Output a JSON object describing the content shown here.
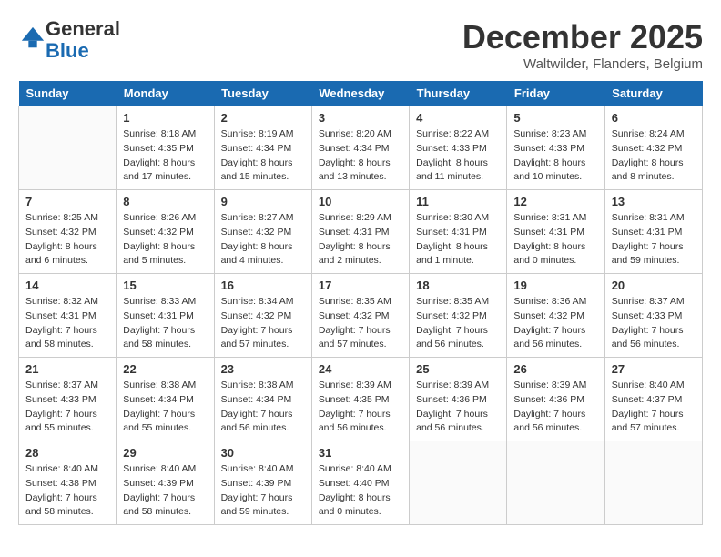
{
  "logo": {
    "general": "General",
    "blue": "Blue"
  },
  "header": {
    "month": "December 2025",
    "location": "Waltwilder, Flanders, Belgium"
  },
  "days_of_week": [
    "Sunday",
    "Monday",
    "Tuesday",
    "Wednesday",
    "Thursday",
    "Friday",
    "Saturday"
  ],
  "weeks": [
    [
      {
        "day": "",
        "info": ""
      },
      {
        "day": "1",
        "info": "Sunrise: 8:18 AM\nSunset: 4:35 PM\nDaylight: 8 hours\nand 17 minutes."
      },
      {
        "day": "2",
        "info": "Sunrise: 8:19 AM\nSunset: 4:34 PM\nDaylight: 8 hours\nand 15 minutes."
      },
      {
        "day": "3",
        "info": "Sunrise: 8:20 AM\nSunset: 4:34 PM\nDaylight: 8 hours\nand 13 minutes."
      },
      {
        "day": "4",
        "info": "Sunrise: 8:22 AM\nSunset: 4:33 PM\nDaylight: 8 hours\nand 11 minutes."
      },
      {
        "day": "5",
        "info": "Sunrise: 8:23 AM\nSunset: 4:33 PM\nDaylight: 8 hours\nand 10 minutes."
      },
      {
        "day": "6",
        "info": "Sunrise: 8:24 AM\nSunset: 4:32 PM\nDaylight: 8 hours\nand 8 minutes."
      }
    ],
    [
      {
        "day": "7",
        "info": "Sunrise: 8:25 AM\nSunset: 4:32 PM\nDaylight: 8 hours\nand 6 minutes."
      },
      {
        "day": "8",
        "info": "Sunrise: 8:26 AM\nSunset: 4:32 PM\nDaylight: 8 hours\nand 5 minutes."
      },
      {
        "day": "9",
        "info": "Sunrise: 8:27 AM\nSunset: 4:32 PM\nDaylight: 8 hours\nand 4 minutes."
      },
      {
        "day": "10",
        "info": "Sunrise: 8:29 AM\nSunset: 4:31 PM\nDaylight: 8 hours\nand 2 minutes."
      },
      {
        "day": "11",
        "info": "Sunrise: 8:30 AM\nSunset: 4:31 PM\nDaylight: 8 hours\nand 1 minute."
      },
      {
        "day": "12",
        "info": "Sunrise: 8:31 AM\nSunset: 4:31 PM\nDaylight: 8 hours\nand 0 minutes."
      },
      {
        "day": "13",
        "info": "Sunrise: 8:31 AM\nSunset: 4:31 PM\nDaylight: 7 hours\nand 59 minutes."
      }
    ],
    [
      {
        "day": "14",
        "info": "Sunrise: 8:32 AM\nSunset: 4:31 PM\nDaylight: 7 hours\nand 58 minutes."
      },
      {
        "day": "15",
        "info": "Sunrise: 8:33 AM\nSunset: 4:31 PM\nDaylight: 7 hours\nand 58 minutes."
      },
      {
        "day": "16",
        "info": "Sunrise: 8:34 AM\nSunset: 4:32 PM\nDaylight: 7 hours\nand 57 minutes."
      },
      {
        "day": "17",
        "info": "Sunrise: 8:35 AM\nSunset: 4:32 PM\nDaylight: 7 hours\nand 57 minutes."
      },
      {
        "day": "18",
        "info": "Sunrise: 8:35 AM\nSunset: 4:32 PM\nDaylight: 7 hours\nand 56 minutes."
      },
      {
        "day": "19",
        "info": "Sunrise: 8:36 AM\nSunset: 4:32 PM\nDaylight: 7 hours\nand 56 minutes."
      },
      {
        "day": "20",
        "info": "Sunrise: 8:37 AM\nSunset: 4:33 PM\nDaylight: 7 hours\nand 56 minutes."
      }
    ],
    [
      {
        "day": "21",
        "info": "Sunrise: 8:37 AM\nSunset: 4:33 PM\nDaylight: 7 hours\nand 55 minutes."
      },
      {
        "day": "22",
        "info": "Sunrise: 8:38 AM\nSunset: 4:34 PM\nDaylight: 7 hours\nand 55 minutes."
      },
      {
        "day": "23",
        "info": "Sunrise: 8:38 AM\nSunset: 4:34 PM\nDaylight: 7 hours\nand 56 minutes."
      },
      {
        "day": "24",
        "info": "Sunrise: 8:39 AM\nSunset: 4:35 PM\nDaylight: 7 hours\nand 56 minutes."
      },
      {
        "day": "25",
        "info": "Sunrise: 8:39 AM\nSunset: 4:36 PM\nDaylight: 7 hours\nand 56 minutes."
      },
      {
        "day": "26",
        "info": "Sunrise: 8:39 AM\nSunset: 4:36 PM\nDaylight: 7 hours\nand 56 minutes."
      },
      {
        "day": "27",
        "info": "Sunrise: 8:40 AM\nSunset: 4:37 PM\nDaylight: 7 hours\nand 57 minutes."
      }
    ],
    [
      {
        "day": "28",
        "info": "Sunrise: 8:40 AM\nSunset: 4:38 PM\nDaylight: 7 hours\nand 58 minutes."
      },
      {
        "day": "29",
        "info": "Sunrise: 8:40 AM\nSunset: 4:39 PM\nDaylight: 7 hours\nand 58 minutes."
      },
      {
        "day": "30",
        "info": "Sunrise: 8:40 AM\nSunset: 4:39 PM\nDaylight: 7 hours\nand 59 minutes."
      },
      {
        "day": "31",
        "info": "Sunrise: 8:40 AM\nSunset: 4:40 PM\nDaylight: 8 hours\nand 0 minutes."
      },
      {
        "day": "",
        "info": ""
      },
      {
        "day": "",
        "info": ""
      },
      {
        "day": "",
        "info": ""
      }
    ]
  ]
}
